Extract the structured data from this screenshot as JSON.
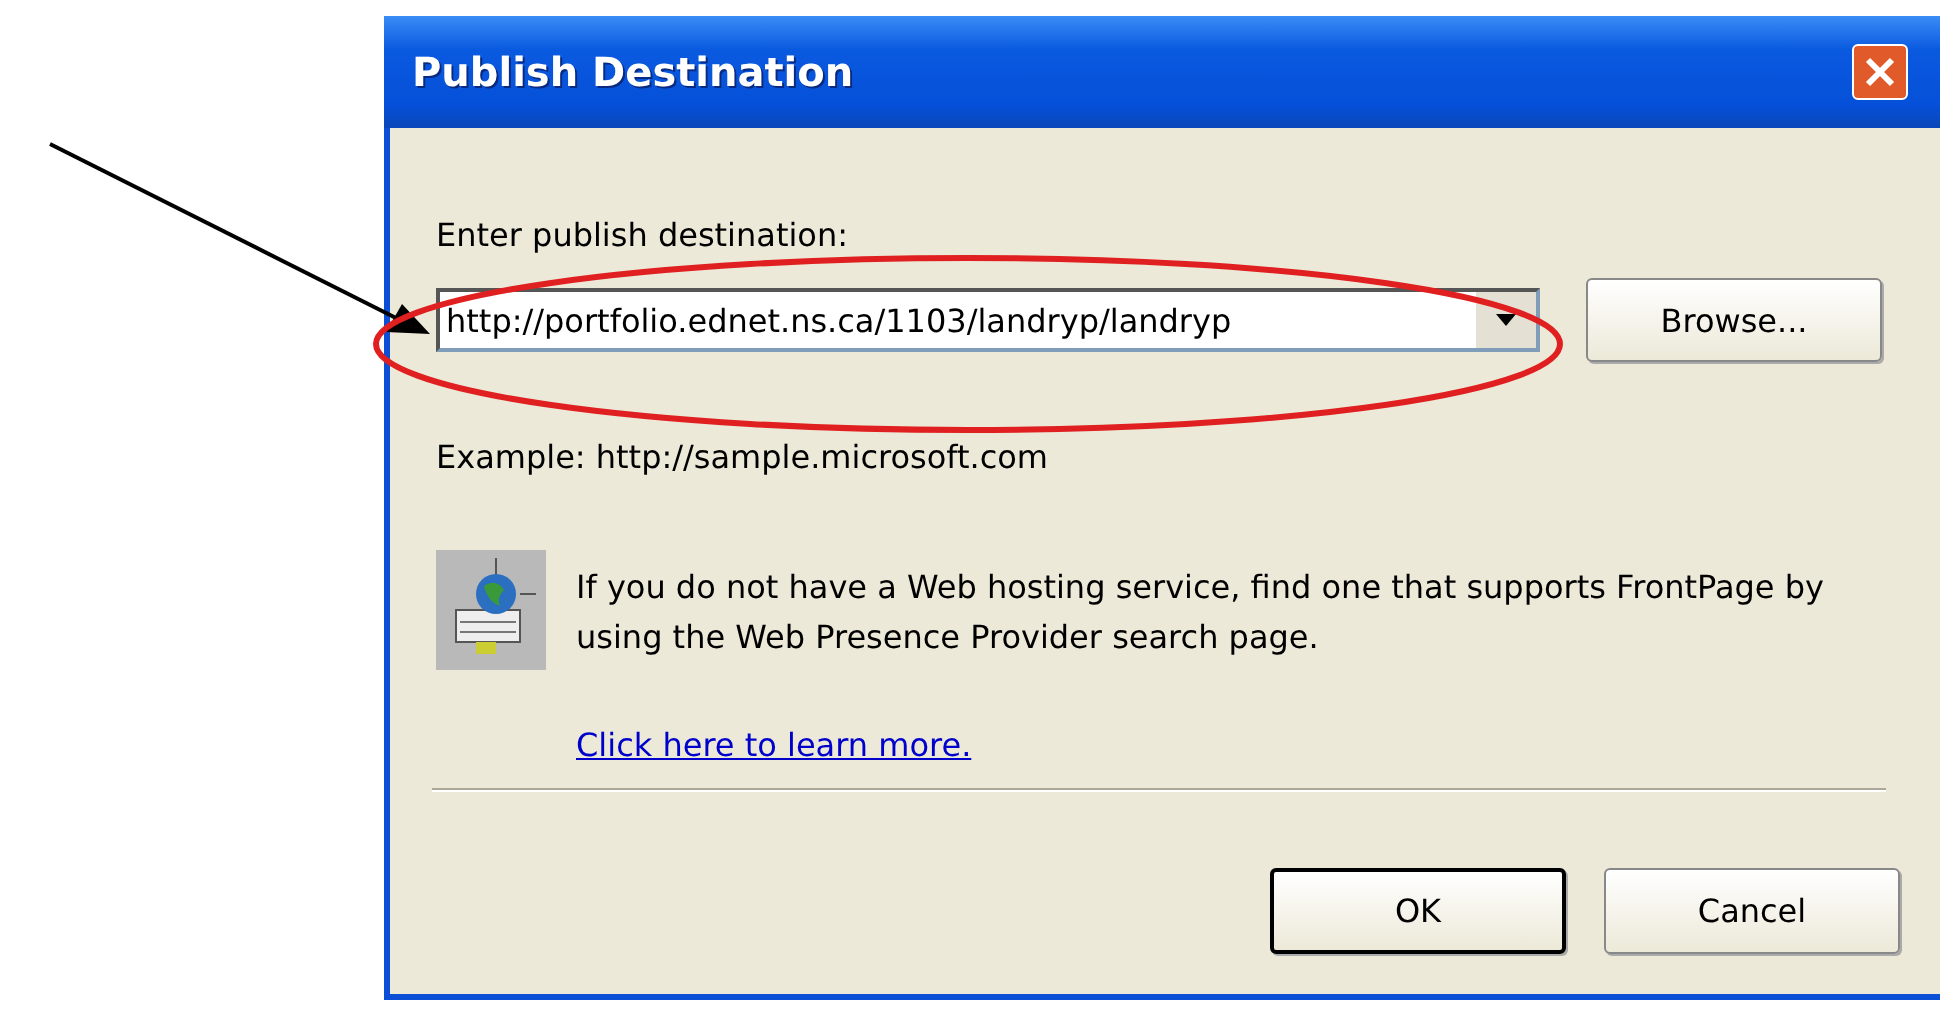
{
  "window": {
    "title": "Publish Destination"
  },
  "destination": {
    "label": "Enter publish destination:",
    "value": "http://portfolio.ednet.ns.ca/1103/landryp/landryp",
    "example": "Example: http://sample.microsoft.com"
  },
  "browse_button": "Browse...",
  "info": {
    "text": "If you do not have a Web hosting service, find one that supports FrontPage by using the Web Presence Provider search page.",
    "link": "Click here to learn more."
  },
  "buttons": [
    {
      "label": "OK",
      "default": true
    },
    {
      "label": "Cancel",
      "default": false
    }
  ],
  "annotations": [
    {
      "kind": "arrow"
    },
    {
      "kind": "ellipse"
    }
  ]
}
